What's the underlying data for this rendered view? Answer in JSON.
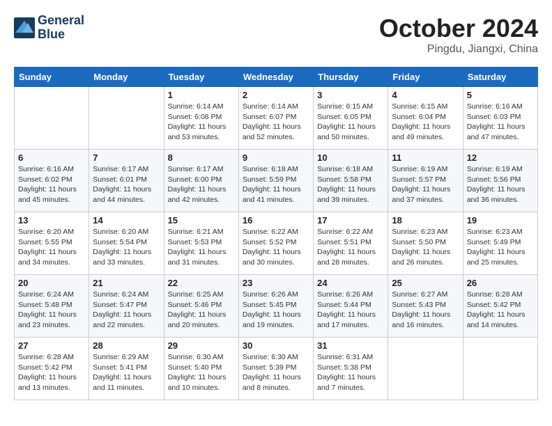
{
  "header": {
    "logo_line1": "General",
    "logo_line2": "Blue",
    "month": "October 2024",
    "location": "Pingdu, Jiangxi, China"
  },
  "weekdays": [
    "Sunday",
    "Monday",
    "Tuesday",
    "Wednesday",
    "Thursday",
    "Friday",
    "Saturday"
  ],
  "weeks": [
    [
      {
        "day": "",
        "info": ""
      },
      {
        "day": "",
        "info": ""
      },
      {
        "day": "1",
        "info": "Sunrise: 6:14 AM\nSunset: 6:08 PM\nDaylight: 11 hours and 53 minutes."
      },
      {
        "day": "2",
        "info": "Sunrise: 6:14 AM\nSunset: 6:07 PM\nDaylight: 11 hours and 52 minutes."
      },
      {
        "day": "3",
        "info": "Sunrise: 6:15 AM\nSunset: 6:05 PM\nDaylight: 11 hours and 50 minutes."
      },
      {
        "day": "4",
        "info": "Sunrise: 6:15 AM\nSunset: 6:04 PM\nDaylight: 11 hours and 49 minutes."
      },
      {
        "day": "5",
        "info": "Sunrise: 6:16 AM\nSunset: 6:03 PM\nDaylight: 11 hours and 47 minutes."
      }
    ],
    [
      {
        "day": "6",
        "info": "Sunrise: 6:16 AM\nSunset: 6:02 PM\nDaylight: 11 hours and 45 minutes."
      },
      {
        "day": "7",
        "info": "Sunrise: 6:17 AM\nSunset: 6:01 PM\nDaylight: 11 hours and 44 minutes."
      },
      {
        "day": "8",
        "info": "Sunrise: 6:17 AM\nSunset: 6:00 PM\nDaylight: 11 hours and 42 minutes."
      },
      {
        "day": "9",
        "info": "Sunrise: 6:18 AM\nSunset: 5:59 PM\nDaylight: 11 hours and 41 minutes."
      },
      {
        "day": "10",
        "info": "Sunrise: 6:18 AM\nSunset: 5:58 PM\nDaylight: 11 hours and 39 minutes."
      },
      {
        "day": "11",
        "info": "Sunrise: 6:19 AM\nSunset: 5:57 PM\nDaylight: 11 hours and 37 minutes."
      },
      {
        "day": "12",
        "info": "Sunrise: 6:19 AM\nSunset: 5:56 PM\nDaylight: 11 hours and 36 minutes."
      }
    ],
    [
      {
        "day": "13",
        "info": "Sunrise: 6:20 AM\nSunset: 5:55 PM\nDaylight: 11 hours and 34 minutes."
      },
      {
        "day": "14",
        "info": "Sunrise: 6:20 AM\nSunset: 5:54 PM\nDaylight: 11 hours and 33 minutes."
      },
      {
        "day": "15",
        "info": "Sunrise: 6:21 AM\nSunset: 5:53 PM\nDaylight: 11 hours and 31 minutes."
      },
      {
        "day": "16",
        "info": "Sunrise: 6:22 AM\nSunset: 5:52 PM\nDaylight: 11 hours and 30 minutes."
      },
      {
        "day": "17",
        "info": "Sunrise: 6:22 AM\nSunset: 5:51 PM\nDaylight: 11 hours and 28 minutes."
      },
      {
        "day": "18",
        "info": "Sunrise: 6:23 AM\nSunset: 5:50 PM\nDaylight: 11 hours and 26 minutes."
      },
      {
        "day": "19",
        "info": "Sunrise: 6:23 AM\nSunset: 5:49 PM\nDaylight: 11 hours and 25 minutes."
      }
    ],
    [
      {
        "day": "20",
        "info": "Sunrise: 6:24 AM\nSunset: 5:48 PM\nDaylight: 11 hours and 23 minutes."
      },
      {
        "day": "21",
        "info": "Sunrise: 6:24 AM\nSunset: 5:47 PM\nDaylight: 11 hours and 22 minutes."
      },
      {
        "day": "22",
        "info": "Sunrise: 6:25 AM\nSunset: 5:46 PM\nDaylight: 11 hours and 20 minutes."
      },
      {
        "day": "23",
        "info": "Sunrise: 6:26 AM\nSunset: 5:45 PM\nDaylight: 11 hours and 19 minutes."
      },
      {
        "day": "24",
        "info": "Sunrise: 6:26 AM\nSunset: 5:44 PM\nDaylight: 11 hours and 17 minutes."
      },
      {
        "day": "25",
        "info": "Sunrise: 6:27 AM\nSunset: 5:43 PM\nDaylight: 11 hours and 16 minutes."
      },
      {
        "day": "26",
        "info": "Sunrise: 6:28 AM\nSunset: 5:42 PM\nDaylight: 11 hours and 14 minutes."
      }
    ],
    [
      {
        "day": "27",
        "info": "Sunrise: 6:28 AM\nSunset: 5:42 PM\nDaylight: 11 hours and 13 minutes."
      },
      {
        "day": "28",
        "info": "Sunrise: 6:29 AM\nSunset: 5:41 PM\nDaylight: 11 hours and 11 minutes."
      },
      {
        "day": "29",
        "info": "Sunrise: 6:30 AM\nSunset: 5:40 PM\nDaylight: 11 hours and 10 minutes."
      },
      {
        "day": "30",
        "info": "Sunrise: 6:30 AM\nSunset: 5:39 PM\nDaylight: 11 hours and 8 minutes."
      },
      {
        "day": "31",
        "info": "Sunrise: 6:31 AM\nSunset: 5:38 PM\nDaylight: 11 hours and 7 minutes."
      },
      {
        "day": "",
        "info": ""
      },
      {
        "day": "",
        "info": ""
      }
    ]
  ]
}
